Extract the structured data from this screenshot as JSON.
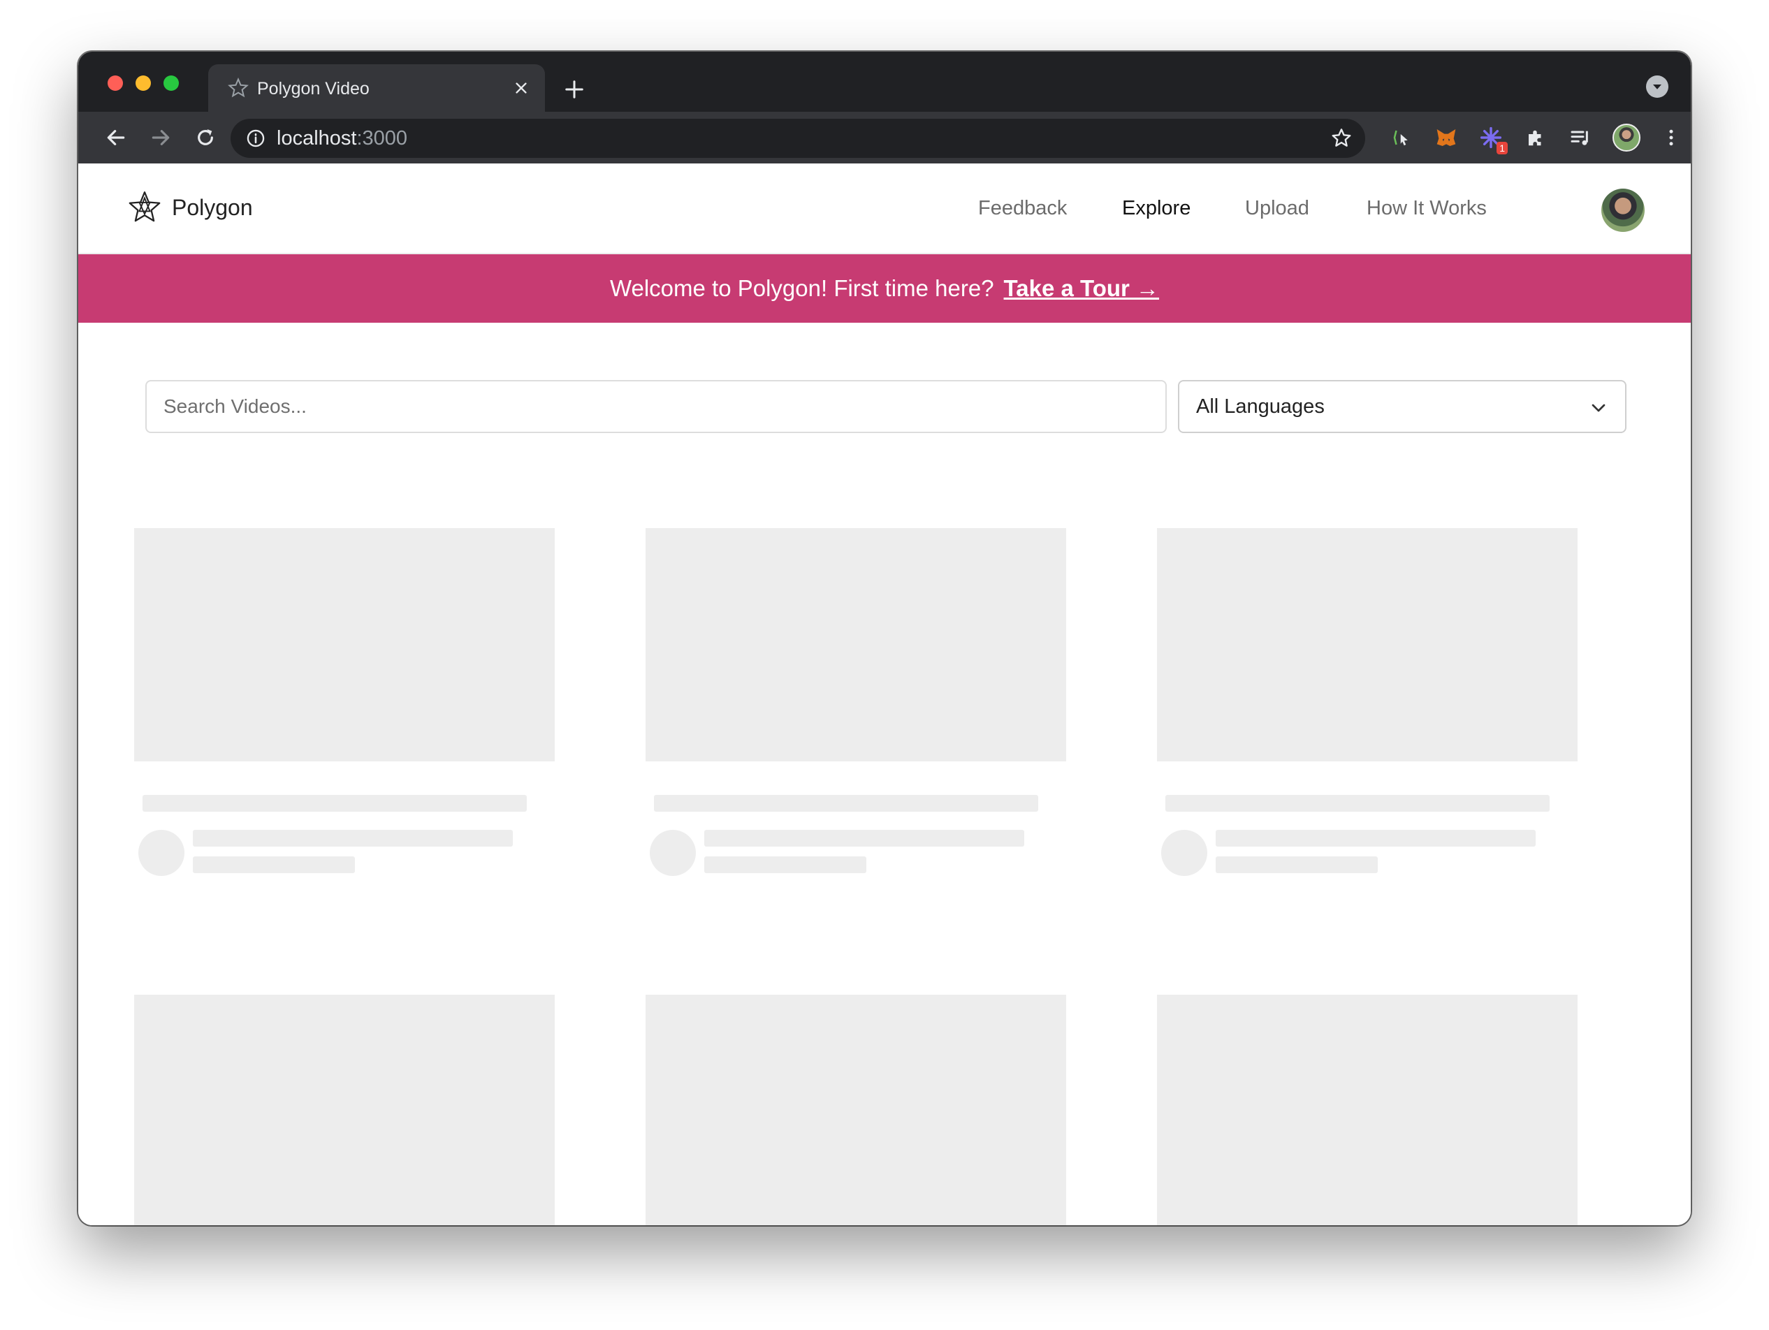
{
  "browser": {
    "tab_title": "Polygon Video",
    "url_host": "localhost",
    "url_port": ":3000",
    "extension_badge": "1"
  },
  "navbar": {
    "brand": "Polygon",
    "links": [
      {
        "label": "Feedback",
        "active": false
      },
      {
        "label": "Explore",
        "active": true
      },
      {
        "label": "Upload",
        "active": false
      },
      {
        "label": "How It Works",
        "active": false
      }
    ]
  },
  "banner": {
    "text": "Welcome to Polygon! First time here?",
    "cta": "Take a Tour →",
    "color": "#c73b72"
  },
  "search": {
    "placeholder": "Search Videos...",
    "value": ""
  },
  "language_select": {
    "selected": "All Languages"
  },
  "skeleton_cards": 6,
  "icons": [
    "polygon-star-icon",
    "close-icon",
    "plus-icon",
    "back-arrow-icon",
    "forward-arrow-icon",
    "reload-icon",
    "info-icon",
    "bookmark-star-icon",
    "puzzle-icon",
    "media-icon",
    "more-vert-icon",
    "chevron-down-icon"
  ]
}
